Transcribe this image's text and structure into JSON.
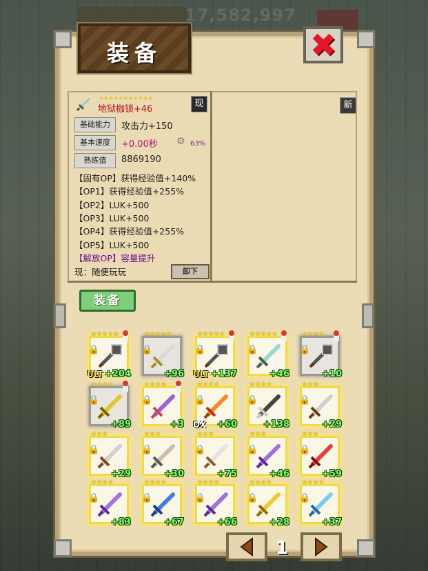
{
  "top": {
    "gold": "17,582,997"
  },
  "window": {
    "title": "装备",
    "close_label": "✖"
  },
  "item": {
    "name": "地狱枷锁+46",
    "stars": "★★★★★★★★★★★",
    "state_badge": "现",
    "new_badge": "新",
    "base_label": "基础能力",
    "base_value": "攻击力+150",
    "speed_label": "基本速度",
    "speed_value": "+0.00秒",
    "speed_percent": "63%",
    "prof_label": "熟练值",
    "prof_value": "8869190",
    "lines": [
      "【固有OP】获得经验值+140%",
      "【OP1】获得经验值+255%",
      "【OP2】LUK+500",
      "【OP3】LUK+500",
      "【OP4】获得经验值+255%",
      "【OP5】LUK+500",
      "【解放OP】容量提升"
    ],
    "owner": "现：随便玩玩",
    "unequip_label": "卸下"
  },
  "equip_button": "装备",
  "slots": [
    {
      "stars": "★★★★★",
      "level": "+204",
      "tag": "ULT",
      "icon": "chain-flail-icon",
      "style": "gold",
      "avatar": true
    },
    {
      "stars": "★★★★★",
      "level": "+96",
      "tag": "",
      "icon": "saber-icon",
      "style": "gray",
      "avatar": false
    },
    {
      "stars": "★★★★★",
      "level": "+137",
      "tag": "ULT",
      "icon": "chain-flail-icon",
      "style": "gold",
      "avatar": true
    },
    {
      "stars": "★★★★★",
      "level": "+46",
      "tag": "",
      "icon": "teal-sword-icon",
      "style": "gold",
      "avatar": true
    },
    {
      "stars": "★★★★",
      "level": "+10",
      "tag": "",
      "icon": "chain-flail-icon",
      "style": "gray",
      "avatar": true
    },
    {
      "stars": "★★★★",
      "level": "+89",
      "tag": "",
      "icon": "gold-serpent-sword-icon",
      "style": "gray",
      "avatar": true
    },
    {
      "stars": "★★★★",
      "level": "+3",
      "tag": "",
      "icon": "purple-blade-icon",
      "style": "gold",
      "avatar": true
    },
    {
      "stars": "★★★★",
      "level": "+60",
      "tag": "DX",
      "icon": "flame-sword-icon",
      "style": "gold",
      "avatar": false
    },
    {
      "stars": "★★★★",
      "level": "+138",
      "tag": "",
      "icon": "dark-sword-icon",
      "style": "gold",
      "avatar": false
    },
    {
      "stars": "★★★",
      "level": "+29",
      "tag": "",
      "icon": "knife-icon",
      "style": "gold",
      "avatar": false
    },
    {
      "stars": "★★★",
      "level": "+29",
      "tag": "",
      "icon": "iron-sword-icon",
      "style": "gold",
      "avatar": false
    },
    {
      "stars": "★★★",
      "level": "+30",
      "tag": "",
      "icon": "bone-sword-icon",
      "style": "gold",
      "avatar": false
    },
    {
      "stars": "★★★",
      "level": "+75",
      "tag": "",
      "icon": "short-knife-icon",
      "style": "gold",
      "avatar": false
    },
    {
      "stars": "★★★",
      "level": "+46",
      "tag": "",
      "icon": "violet-sword-icon",
      "style": "gold",
      "avatar": false
    },
    {
      "stars": "★★★",
      "level": "+59",
      "tag": "",
      "icon": "red-sword-icon",
      "style": "gold",
      "avatar": false
    },
    {
      "stars": "★★★★",
      "level": "+83",
      "tag": "",
      "icon": "violet-sword-icon",
      "style": "gold",
      "avatar": false
    },
    {
      "stars": "★★★★",
      "level": "+67",
      "tag": "",
      "icon": "blue-broadsword-icon",
      "style": "gold",
      "avatar": false
    },
    {
      "stars": "★★★★",
      "level": "+66",
      "tag": "",
      "icon": "violet-sword-icon",
      "style": "gold",
      "avatar": false
    },
    {
      "stars": "★★★★",
      "level": "+28",
      "tag": "",
      "icon": "gold-sword-icon",
      "style": "gold",
      "avatar": false
    },
    {
      "stars": "★★★★",
      "level": "+37",
      "tag": "",
      "icon": "ice-sword-icon",
      "style": "gold",
      "avatar": false
    }
  ],
  "pager": {
    "page": "1"
  },
  "colors": {
    "gold_glow": "#f1d94a",
    "level_green": "#7dff67",
    "accent_red": "#e5162a",
    "equip_green": "#7fcf7a"
  }
}
